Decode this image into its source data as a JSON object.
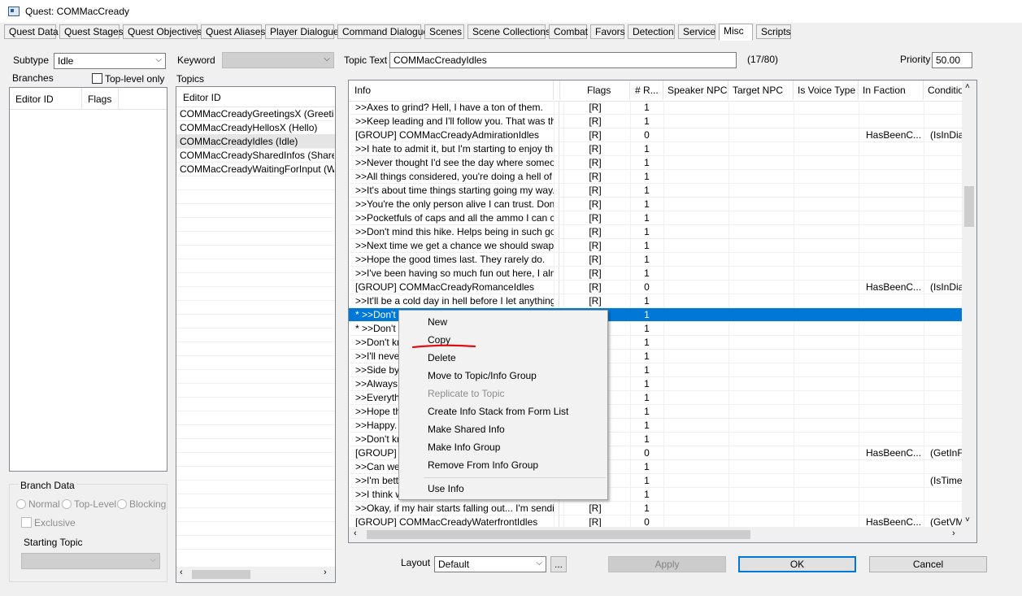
{
  "window": {
    "title": "Quest: COMMacCready"
  },
  "tabs": [
    {
      "label": "Quest Data"
    },
    {
      "label": "Quest Stages"
    },
    {
      "label": "Quest Objectives"
    },
    {
      "label": "Quest Aliases"
    },
    {
      "label": "Player Dialogue"
    },
    {
      "label": "Command Dialogue"
    },
    {
      "label": "Scenes"
    },
    {
      "label": "Scene Collections"
    },
    {
      "label": "Combat"
    },
    {
      "label": "Favors"
    },
    {
      "label": "Detection"
    },
    {
      "label": "Service"
    },
    {
      "label": "Misc"
    },
    {
      "label": "Scripts"
    }
  ],
  "left": {
    "subtype_label": "Subtype",
    "subtype_value": "Idle",
    "branches_label": "Branches",
    "toplevel_only_label": "Top-level only",
    "branches_cols": [
      "Editor ID",
      "Flags"
    ],
    "branch_data": {
      "title": "Branch Data",
      "normal": "Normal",
      "toplevel": "Top-Level",
      "blocking": "Blocking",
      "exclusive": "Exclusive",
      "starting_topic": "Starting Topic"
    }
  },
  "middle": {
    "keyword_label": "Keyword",
    "topics_label": "Topics",
    "topics_col": "Editor ID",
    "topics": [
      "COMMacCreadyGreetingsX (Greeting)",
      "COMMacCreadyHellosX (Hello)",
      "COMMacCreadyIdles (Idle)",
      "COMMacCreadySharedInfos (SharedInfo)",
      "COMMacCreadyWaitingForInput (WaitingForInput)"
    ]
  },
  "right": {
    "topic_text_label": "Topic Text",
    "topic_text_value": "COMMacCreadyIdles",
    "topic_text_count": "(17/80)",
    "priority_label": "Priority",
    "priority_value": "50.00",
    "columns": [
      "Info",
      "Flags",
      "# R...",
      "Speaker NPC",
      "Target NPC",
      "Is Voice Type",
      "In Faction",
      "Condition"
    ],
    "rows": [
      {
        "info": ">>Axes to grind? Hell, I have a ton of them.",
        "flags": "[R]",
        "r": "1",
        "faction": "",
        "cond": ""
      },
      {
        "info": ">>Keep leading and I'll follow you. That was the ...",
        "flags": "[R]",
        "r": "1",
        "faction": "",
        "cond": ""
      },
      {
        "info": "[GROUP] COMMacCreadyAdmirationIdles",
        "flags": "[R]",
        "r": "0",
        "faction": "HasBeenC...",
        "cond": "(IsInDial"
      },
      {
        "info": ">>I hate to admit it, but I'm starting to enjoy this litt...",
        "flags": "[R]",
        "r": "1",
        "faction": "",
        "cond": ""
      },
      {
        "info": ">>Never thought I'd see the day where someone'...",
        "flags": "[R]",
        "r": "1",
        "faction": "",
        "cond": ""
      },
      {
        "info": ">>All things considered, you're doing a hell of a job.",
        "flags": "[R]",
        "r": "1",
        "faction": "",
        "cond": ""
      },
      {
        "info": ">>It's about time things starting going my way.",
        "flags": "[R]",
        "r": "1",
        "faction": "",
        "cond": ""
      },
      {
        "info": ">>You're the only person alive I can trust. Don't d...",
        "flags": "[R]",
        "r": "1",
        "faction": "",
        "cond": ""
      },
      {
        "info": ">>Pocketfuls of caps and all the ammo I can carr...",
        "flags": "[R]",
        "r": "1",
        "faction": "",
        "cond": ""
      },
      {
        "info": ">>Don't mind this hike. Helps being in such good ...",
        "flags": "[R]",
        "r": "1",
        "faction": "",
        "cond": ""
      },
      {
        "info": ">>Next time we get a chance we should swap ro...",
        "flags": "[R]",
        "r": "1",
        "faction": "",
        "cond": ""
      },
      {
        "info": ">>Hope the good times last. They rarely do.",
        "flags": "[R]",
        "r": "1",
        "faction": "",
        "cond": ""
      },
      {
        "info": ">>I've been having so much fun out here, I almos...",
        "flags": "[R]",
        "r": "1",
        "faction": "",
        "cond": ""
      },
      {
        "info": "[GROUP] COMMacCreadyRomanceIdles",
        "flags": "[R]",
        "r": "0",
        "faction": "HasBeenC...",
        "cond": "(IsInDial"
      },
      {
        "info": ">>It'll be a cold day in hell before I let anything ba...",
        "flags": "[R]",
        "r": "1",
        "faction": "",
        "cond": ""
      },
      {
        "info": "* >>Don't g",
        "flags": "",
        "r": "1",
        "faction": "",
        "cond": "",
        "selected": true
      },
      {
        "info": "* >>Don't g",
        "flags": "",
        "r": "1",
        "faction": "",
        "cond": ""
      },
      {
        "info": ">>Don't kno",
        "flags": "",
        "r": "1",
        "faction": "",
        "cond": ""
      },
      {
        "info": ">>I'll never",
        "flags": "",
        "r": "1",
        "faction": "",
        "cond": ""
      },
      {
        "info": ">>Side by s",
        "flags": "",
        "r": "1",
        "faction": "",
        "cond": ""
      },
      {
        "info": ">>Always k",
        "flags": "",
        "r": "1",
        "faction": "",
        "cond": ""
      },
      {
        "info": ">>Everythin",
        "flags": "",
        "r": "1",
        "faction": "",
        "cond": ""
      },
      {
        "info": ">>Hope this",
        "flags": "",
        "r": "1",
        "faction": "",
        "cond": ""
      },
      {
        "info": ">>Happy. F",
        "flags": "",
        "r": "1",
        "faction": "",
        "cond": ""
      },
      {
        "info": ">>Don't kno",
        "flags": "",
        "r": "1",
        "faction": "",
        "cond": ""
      },
      {
        "info": "[GROUP] C",
        "flags": "",
        "r": "0",
        "faction": "HasBeenC...",
        "cond": "(GetInFa"
      },
      {
        "info": ">>Can we h",
        "flags": "",
        "r": "1",
        "faction": "",
        "cond": ""
      },
      {
        "info": ">>I'm bettin",
        "flags": "",
        "r": "1",
        "faction": "",
        "cond": "(IsTimeS"
      },
      {
        "info": ">>I think wl",
        "flags": "",
        "r": "1",
        "faction": "",
        "cond": ""
      },
      {
        "info": ">>Okay, if my hair starts falling out... I'm sending y...",
        "flags": "[R]",
        "r": "1",
        "faction": "",
        "cond": ""
      },
      {
        "info": "[GROUP] COMMacCreadyWaterfrontIdles",
        "flags": "[R]",
        "r": "0",
        "faction": "HasBeenC...",
        "cond": "(GetVM("
      }
    ]
  },
  "context_menu": {
    "items": [
      {
        "label": "New",
        "enabled": true
      },
      {
        "label": "Copy",
        "enabled": true
      },
      {
        "label": "Delete",
        "enabled": true
      },
      {
        "label": "Move to Topic/Info Group",
        "enabled": true
      },
      {
        "label": "Replicate to Topic",
        "enabled": false
      },
      {
        "label": "Create Info Stack from Form List",
        "enabled": true
      },
      {
        "label": "Make Shared Info",
        "enabled": true
      },
      {
        "label": "Make Info Group",
        "enabled": true
      },
      {
        "label": "Remove From Info Group",
        "enabled": true
      },
      {
        "label": "Use Info",
        "enabled": true
      }
    ],
    "underline_color": "#e01010"
  },
  "footer": {
    "layout_label": "Layout",
    "layout_value": "Default",
    "ellipsis": "...",
    "apply": "Apply",
    "ok": "OK",
    "cancel": "Cancel"
  },
  "colors": {
    "selection": "#0078d7",
    "default_border": "#0078d7"
  }
}
